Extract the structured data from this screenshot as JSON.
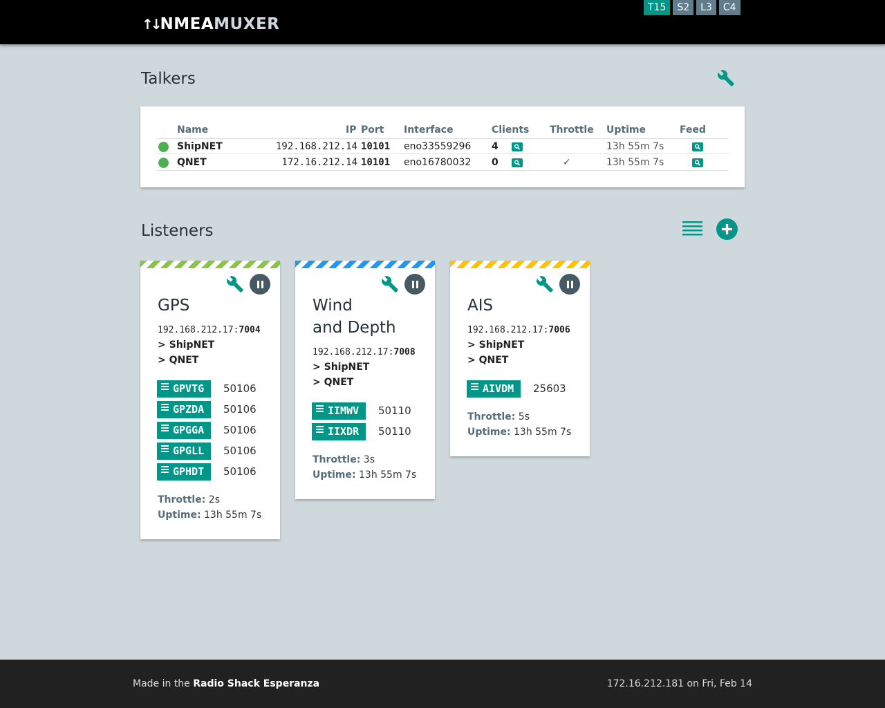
{
  "header": {
    "logo_arrows": "↑↓",
    "logo_part1": "NMEA",
    "logo_part2": "MUXER",
    "badges": [
      {
        "label": "T15",
        "active": true
      },
      {
        "label": "S2",
        "active": false
      },
      {
        "label": "L3",
        "active": false
      },
      {
        "label": "C4",
        "active": false
      }
    ]
  },
  "talkers": {
    "title": "Talkers",
    "settings_icon": "wrench-icon",
    "columns": {
      "name": "Name",
      "ip": "IP",
      "port": "Port",
      "interface": "Interface",
      "clients": "Clients",
      "throttle": "Throttle",
      "uptime": "Uptime",
      "feed": "Feed"
    },
    "rows": [
      {
        "status": "online",
        "name": "ShipNET",
        "ip": "192.168.212.14",
        "port": "10101",
        "interface": "eno33559296",
        "clients": "4",
        "throttle": "",
        "uptime": "13h 55m 7s"
      },
      {
        "status": "online",
        "name": "QNET",
        "ip": "172.16.212.14",
        "port": "10101",
        "interface": "eno16780032",
        "clients": "0",
        "throttle": "✓",
        "uptime": "13h 55m 7s"
      }
    ]
  },
  "listeners": {
    "title": "Listeners",
    "list_icon": "list-icon",
    "add_icon": "add-circle-icon",
    "cards": [
      {
        "name_line1": "GPS",
        "name_line2": "",
        "ip": "192.168.212.17:",
        "port": "7004",
        "targets": [
          "> ShipNET",
          "> QNET"
        ],
        "sentences": [
          {
            "tag": "GPVTG",
            "count": "50106"
          },
          {
            "tag": "GPZDA",
            "count": "50106"
          },
          {
            "tag": "GPGGA",
            "count": "50106"
          },
          {
            "tag": "GPGLL",
            "count": "50106"
          },
          {
            "tag": "GPHDT",
            "count": "50106"
          }
        ],
        "throttle_label": "Throttle:",
        "throttle": "2s",
        "uptime_label": "Uptime:",
        "uptime": "13h 55m 7s",
        "color": "#8bc34a"
      },
      {
        "name_line1": "Wind",
        "name_line2": "and Depth",
        "ip": "192.168.212.17:",
        "port": "7008",
        "targets": [
          "> ShipNET",
          "> QNET"
        ],
        "sentences": [
          {
            "tag": "IIMWV",
            "count": "50110"
          },
          {
            "tag": "IIXDR",
            "count": "50110"
          }
        ],
        "throttle_label": "Throttle:",
        "throttle": "3s",
        "uptime_label": "Uptime:",
        "uptime": "13h 55m 7s",
        "color": "#2196f3"
      },
      {
        "name_line1": "AIS",
        "name_line2": "",
        "ip": "192.168.212.17:",
        "port": "7006",
        "targets": [
          "> ShipNET",
          "> QNET"
        ],
        "sentences": [
          {
            "tag": "AIVDM",
            "count": "25603"
          }
        ],
        "throttle_label": "Throttle:",
        "throttle": "5s",
        "uptime_label": "Uptime:",
        "uptime": "13h 55m 7s",
        "color": "#ffc107"
      }
    ]
  },
  "footer": {
    "made_prefix": "Made in the ",
    "made_name": "Radio Shack Esperanza",
    "right": "172.16.212.181 on Fri, Feb 14"
  },
  "colors": {
    "accent": "#009688",
    "header_bg": "#000000",
    "page_bg": "#cfd8dc",
    "footer_bg": "#212121",
    "online": "#4caf50"
  }
}
